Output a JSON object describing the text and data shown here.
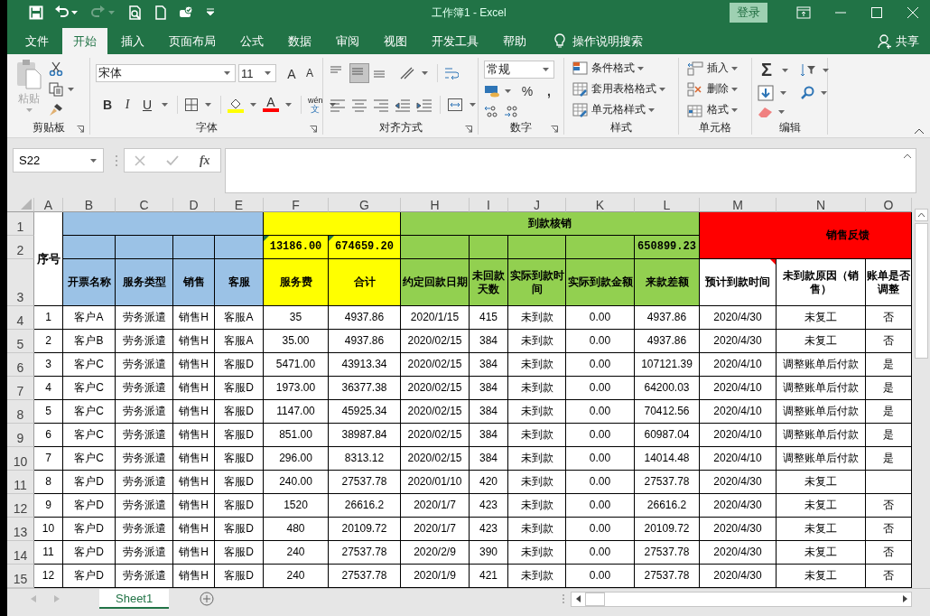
{
  "title_bar": {
    "quick_access": [
      {
        "kind": "save",
        "disabled": false
      },
      {
        "kind": "undo",
        "disabled": false
      },
      {
        "kind": "redo",
        "disabled": true
      },
      {
        "kind": "print_preview",
        "disabled": false
      },
      {
        "kind": "new",
        "disabled": false
      },
      {
        "kind": "touch",
        "disabled": false
      },
      {
        "kind": "customize",
        "disabled": false
      }
    ],
    "title": "工作簿1 - Excel",
    "sign_in": "登录"
  },
  "tabs": [
    {
      "label": "文件",
      "selected": false
    },
    {
      "label": "开始",
      "selected": true
    },
    {
      "label": "插入",
      "selected": false
    },
    {
      "label": "页面布局",
      "selected": false
    },
    {
      "label": "公式",
      "selected": false
    },
    {
      "label": "数据",
      "selected": false
    },
    {
      "label": "审阅",
      "selected": false
    },
    {
      "label": "视图",
      "selected": false
    },
    {
      "label": "开发工具",
      "selected": false
    },
    {
      "label": "帮助",
      "selected": false
    }
  ],
  "tell_me": "操作说明搜索",
  "share": "共享",
  "ribbon": {
    "clipboard": {
      "paste": {
        "label": "粘贴",
        "disabled": true
      },
      "label": "剪贴板"
    },
    "font": {
      "name": "宋体",
      "size": "11",
      "grow": "A",
      "shrink": "A",
      "bold": "B",
      "italic": "I",
      "underline": "U",
      "font_color": "A",
      "phonetic": "wén",
      "phonetic_char": "文",
      "label": "字体"
    },
    "alignment": {
      "vertical": [
        {
          "kind": "top",
          "selected": false
        },
        {
          "kind": "middle",
          "selected": true
        },
        {
          "kind": "bottom",
          "selected": false
        }
      ],
      "label": "对齐方式"
    },
    "number": {
      "format": "常规",
      "percent": "%",
      "comma": ",",
      "label": "数字"
    },
    "styles": {
      "items": [
        "条件格式",
        "套用表格格式",
        "单元格样式"
      ],
      "label": "样式"
    },
    "cells": {
      "items": [
        "插入",
        "删除",
        "格式"
      ],
      "label": "单元格"
    },
    "editing": {
      "sum": "Σ",
      "label": "编辑"
    }
  },
  "formula_bar": {
    "name_box": "S22",
    "fx": "fx"
  },
  "sheet": {
    "columns": [
      "A",
      "B",
      "C",
      "D",
      "E",
      "F",
      "G",
      "H",
      "I",
      "J",
      "K",
      "L",
      "M",
      "N",
      "O"
    ],
    "row_numbers": [
      "1",
      "2",
      "3",
      "4",
      "5",
      "6",
      "7",
      "8",
      "9",
      "10",
      "11",
      "12",
      "13",
      "14",
      "15"
    ],
    "index_heading": "序号",
    "groups": [
      {
        "kind": "split",
        "color": "#9bc2e6",
        "columns": [
          {
            "label": "开票名称",
            "flag": false
          },
          {
            "label": "服务类型",
            "flag": false
          },
          {
            "label": "销售",
            "flag": false
          },
          {
            "label": "客服",
            "flag": false
          }
        ]
      },
      {
        "kind": "split",
        "color": "#ffff00",
        "columns": [
          {
            "label": "服务费",
            "total": "13186.00",
            "flag": true
          },
          {
            "label": "合计",
            "total": "674659.20",
            "flag": true
          }
        ]
      },
      {
        "kind": "split",
        "title": "到款核销",
        "color": "#92d050",
        "columns": [
          {
            "label": "约定回款日期",
            "flag": false
          },
          {
            "label": "未回款天数",
            "flag": false
          },
          {
            "label": "实际到款时间",
            "flag": false
          },
          {
            "label": "实际到款金额",
            "flag": false
          },
          {
            "label": "来款差额",
            "total": "650899.23",
            "flag": false
          }
        ]
      },
      {
        "kind": "merged",
        "title": "销售反馈",
        "color": "#ff0000",
        "columns": [
          {
            "label": "预计到款时间",
            "flag": true
          },
          {
            "label": "未到款原因（销售）",
            "flag": false
          },
          {
            "label": "账单是否调整",
            "flag": false
          }
        ]
      }
    ],
    "rows": [
      [
        "1",
        "客户A",
        "劳务派遣",
        "销售H",
        "客服A",
        "35",
        "4937.86",
        "2020/1/15",
        "415",
        "未到款",
        "0.00",
        "4937.86",
        "2020/4/30",
        "未复工",
        "否"
      ],
      [
        "2",
        "客户B",
        "劳务派遣",
        "销售H",
        "客服A",
        "35.00",
        "4937.86",
        "2020/02/15",
        "384",
        "未到款",
        "0.00",
        "4937.86",
        "2020/4/30",
        "未复工",
        "否"
      ],
      [
        "3",
        "客户C",
        "劳务派遣",
        "销售H",
        "客服D",
        "5471.00",
        "43913.34",
        "2020/02/15",
        "384",
        "未到款",
        "0.00",
        "107121.39",
        "2020/4/10",
        "调整账单后付款",
        "是"
      ],
      [
        "4",
        "客户C",
        "劳务派遣",
        "销售H",
        "客服D",
        "1973.00",
        "36377.38",
        "2020/02/15",
        "384",
        "未到款",
        "0.00",
        "64200.03",
        "2020/4/10",
        "调整账单后付款",
        "是"
      ],
      [
        "5",
        "客户C",
        "劳务派遣",
        "销售H",
        "客服D",
        "1147.00",
        "45925.34",
        "2020/02/15",
        "384",
        "未到款",
        "0.00",
        "70412.56",
        "2020/4/10",
        "调整账单后付款",
        "是"
      ],
      [
        "6",
        "客户C",
        "劳务派遣",
        "销售H",
        "客服D",
        "851.00",
        "38987.84",
        "2020/02/15",
        "384",
        "未到款",
        "0.00",
        "60987.04",
        "2020/4/10",
        "调整账单后付款",
        "是"
      ],
      [
        "7",
        "客户C",
        "劳务派遣",
        "销售H",
        "客服D",
        "296.00",
        "8313.12",
        "2020/02/15",
        "384",
        "未到款",
        "0.00",
        "14014.48",
        "2020/4/10",
        "调整账单后付款",
        "是"
      ],
      [
        "8",
        "客户D",
        "劳务派遣",
        "销售H",
        "客服D",
        "240.00",
        "27537.78",
        "2020/01/10",
        "420",
        "未到款",
        "0.00",
        "27537.78",
        "2020/4/30",
        "未复工",
        ""
      ],
      [
        "9",
        "客户D",
        "劳务派遣",
        "销售H",
        "客服D",
        "1520",
        "26616.2",
        "2020/1/7",
        "423",
        "未到款",
        "0.00",
        "26616.2",
        "2020/4/30",
        "未复工",
        "否"
      ],
      [
        "10",
        "客户D",
        "劳务派遣",
        "销售H",
        "客服D",
        "480",
        "20109.72",
        "2020/1/7",
        "423",
        "未到款",
        "0.00",
        "20109.72",
        "2020/4/30",
        "未复工",
        "否"
      ],
      [
        "11",
        "客户D",
        "劳务派遣",
        "销售H",
        "客服D",
        "240",
        "27537.78",
        "2020/2/9",
        "390",
        "未到款",
        "0.00",
        "27537.78",
        "2020/4/30",
        "未复工",
        "否"
      ],
      [
        "12",
        "客户D",
        "劳务派遣",
        "销售H",
        "客服D",
        "240",
        "27537.78",
        "2020/1/9",
        "421",
        "未到款",
        "0.00",
        "27537.78",
        "2020/4/30",
        "未复工",
        "否"
      ]
    ]
  },
  "sheet_tabs": [
    {
      "label": "Sheet1",
      "selected": true
    }
  ]
}
